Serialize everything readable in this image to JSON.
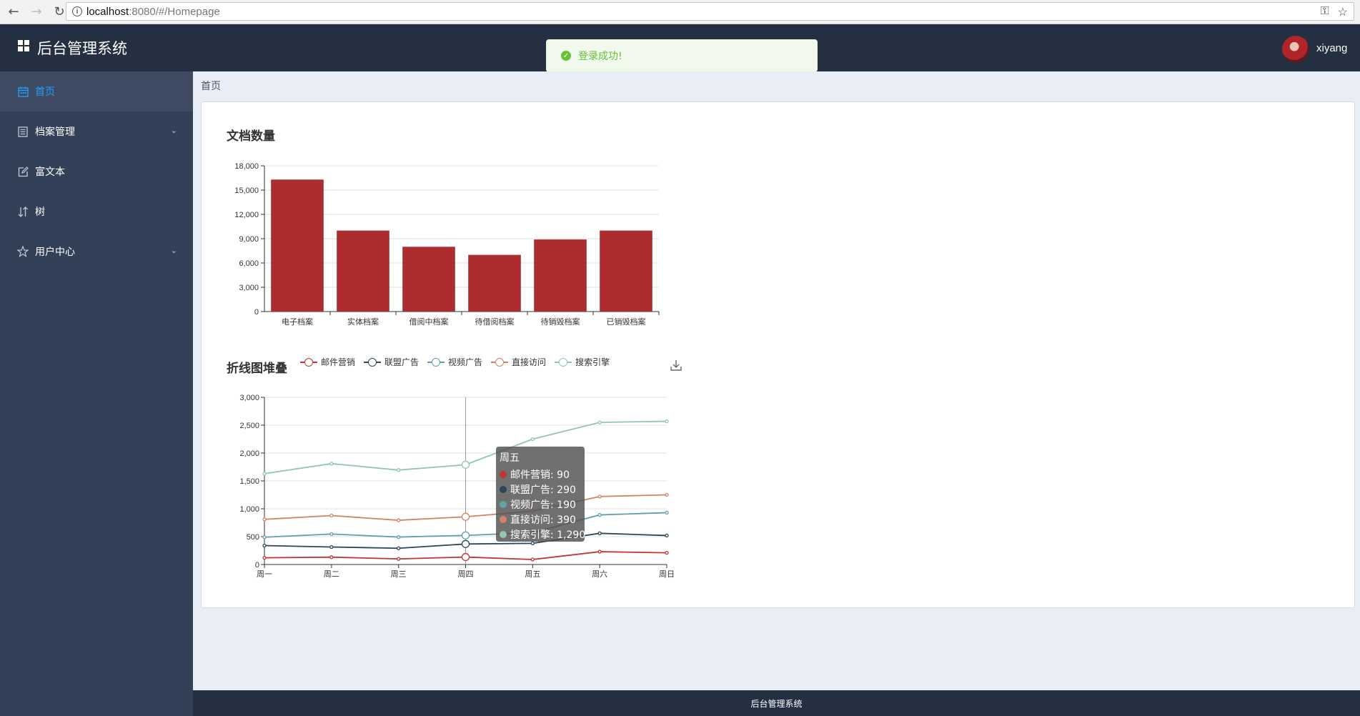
{
  "browser": {
    "url_host": "localhost",
    "url_rest": ":8080/#/Homepage"
  },
  "header": {
    "title": "后台管理系统",
    "username": "xiyang"
  },
  "toast": {
    "message": "登录成功!"
  },
  "sidebar": {
    "items": [
      {
        "label": "首页",
        "icon": "calendar-icon",
        "active": true
      },
      {
        "label": "档案管理",
        "icon": "document-icon",
        "expandable": true
      },
      {
        "label": "富文本",
        "icon": "edit-icon"
      },
      {
        "label": "树",
        "icon": "sort-icon"
      },
      {
        "label": "用户中心",
        "icon": "star-icon",
        "expandable": true
      }
    ]
  },
  "breadcrumb": "首页",
  "footer": "后台管理系统",
  "colors": {
    "bar": "#ad2d2e",
    "header": "#242f42",
    "sidebar": "#324157",
    "accent": "#20a0ff",
    "success": "#67c23a"
  },
  "chart_data": [
    {
      "type": "bar",
      "title": "文档数量",
      "categories": [
        "电子档案",
        "实体档案",
        "借阅中档案",
        "待借阅档案",
        "待销毁档案",
        "已销毁档案"
      ],
      "values": [
        16300,
        10000,
        8000,
        7000,
        8900,
        10000
      ],
      "ylim": [
        0,
        18000
      ],
      "yticks": [
        "0",
        "3,000",
        "6,000",
        "9,000",
        "12,000",
        "15,000",
        "18,000"
      ],
      "ytick_values": [
        0,
        3000,
        6000,
        9000,
        12000,
        15000,
        18000
      ],
      "grid": true
    },
    {
      "type": "line",
      "title": "折线图堆叠",
      "categories": [
        "周一",
        "周二",
        "周三",
        "周四",
        "周五",
        "周六",
        "周日"
      ],
      "ylim": [
        0,
        3000
      ],
      "yticks": [
        "0",
        "500",
        "1,000",
        "1,500",
        "2,000",
        "2,500",
        "3,000"
      ],
      "ytick_values": [
        0,
        500,
        1000,
        1500,
        2000,
        2500,
        3000
      ],
      "stacked": true,
      "legend_position": "top",
      "series": [
        {
          "name": "邮件营销",
          "color": "#c23531",
          "values": [
            120,
            132,
            101,
            134,
            90,
            230,
            210
          ]
        },
        {
          "name": "联盟广告",
          "color": "#2f4554",
          "values": [
            220,
            182,
            191,
            234,
            290,
            330,
            310
          ]
        },
        {
          "name": "视频广告",
          "color": "#61a0a8",
          "values": [
            150,
            232,
            201,
            154,
            190,
            330,
            410
          ]
        },
        {
          "name": "直接访问",
          "color": "#d48265",
          "values": [
            320,
            332,
            301,
            334,
            390,
            330,
            320
          ]
        },
        {
          "name": "搜索引擎",
          "color": "#91c7ae",
          "values": [
            820,
            932,
            901,
            934,
            1290,
            1330,
            1320
          ]
        }
      ],
      "tooltip": {
        "title": "周五",
        "rows": [
          "邮件营销: 90",
          "联盟广告: 290",
          "视频广告: 190",
          "直接访问: 390",
          "搜索引擎: 1,290"
        ]
      }
    }
  ]
}
